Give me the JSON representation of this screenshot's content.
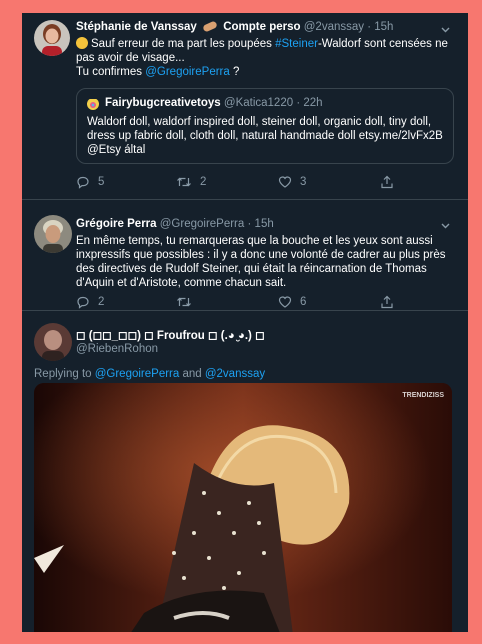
{
  "tweet1": {
    "name": "Stéphanie de Vanssay",
    "badge_text": "Compte perso",
    "handle": "@2vanssay",
    "time": "15h",
    "text_pre": "Sauf erreur de ma part les poupées ",
    "hashtag": "#Steiner",
    "text_post": "-Waldorf sont censées ne pas avoir de visage...",
    "line2_pre": "Tu confirmes ",
    "mention": "@GregoirePerra",
    "line2_post": " ?",
    "reply_count": "5",
    "retweet_count": "2",
    "like_count": "3",
    "quote": {
      "name": "Fairybugcreativetoys",
      "handle": "@Katica1220",
      "time": "22h",
      "text": "Waldorf doll, waldorf inspired doll, steiner doll, organic doll, tiny doll, dress up fabric doll, cloth doll, natural handmade doll etsy.me/2lvFx2B @Etsy által"
    }
  },
  "tweet2": {
    "name": "Grégoire Perra",
    "handle": "@GregoirePerra",
    "time": "15h",
    "text": "En même temps, tu remarqueras que la bouche et les yeux sont aussi inxpressifs que possibles : il y a donc une volonté de cadrer au plus près des directives de Rudolf Steiner, qui était la réincarnation de Thomas d'Aquin et d'Aristote,  comme chacun sait.",
    "reply_count": "2",
    "like_count": "6"
  },
  "tweet3": {
    "name": "◻ (◻◻_◻◻) ◻ Froufrou ◻ (.◕ ̮◕.) ◻",
    "handle": "@RiebenRohon",
    "replying_prefix": "Replying to ",
    "replying_to_1": "@GregoirePerra",
    "replying_and": " and ",
    "replying_to_2": "@2vanssay",
    "media_watermark": "TRENDIZISS"
  },
  "icons": {
    "reply": "reply-icon",
    "retweet": "retweet-icon",
    "like": "heart-icon",
    "share": "share-icon",
    "more": "chevron-down-icon",
    "emoji": "thinking-face-emoji",
    "badge": "bandage-emoji"
  },
  "colors": {
    "background": "#15202b",
    "frame_border": "#f7776f",
    "link": "#1da1f2",
    "secondary_text": "#8899a6",
    "divider": "#38444d"
  }
}
